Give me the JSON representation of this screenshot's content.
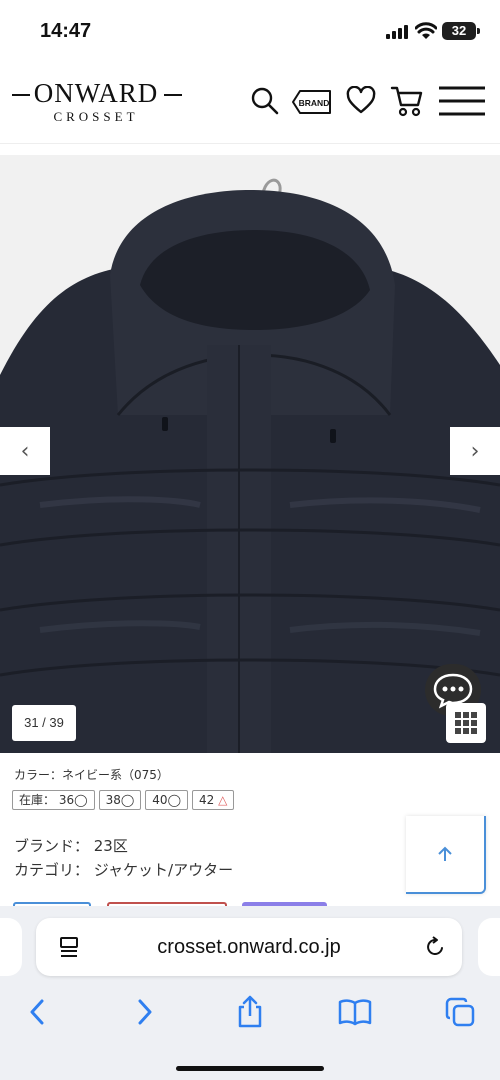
{
  "status_bar": {
    "time": "14:47",
    "battery": "32"
  },
  "header": {
    "logo_main": "ONWARD",
    "logo_sub": "CROSSET",
    "brand_button": "BRAND"
  },
  "gallery": {
    "counter": "31 / 39",
    "prev_arrow": "‹",
    "next_arrow": "›"
  },
  "product": {
    "color_line": "カラー：ネイビー系（075）",
    "stock": [
      {
        "label": "在庫：",
        "size": "36",
        "mark": "◯"
      },
      {
        "size": "38",
        "mark": "◯"
      },
      {
        "size": "40",
        "mark": "◯"
      },
      {
        "size": "42",
        "mark": "△"
      }
    ],
    "brand_line": "ブランド： 23区",
    "category_line": "カテゴリ： ジャケット/アウター"
  },
  "browser": {
    "url": "crosset.onward.co.jp"
  },
  "colors": {
    "accent": "#4a8fd8",
    "low_stock": "#e06060",
    "peek_purple": "#8b7fe8",
    "peek_red": "#c0504d"
  }
}
